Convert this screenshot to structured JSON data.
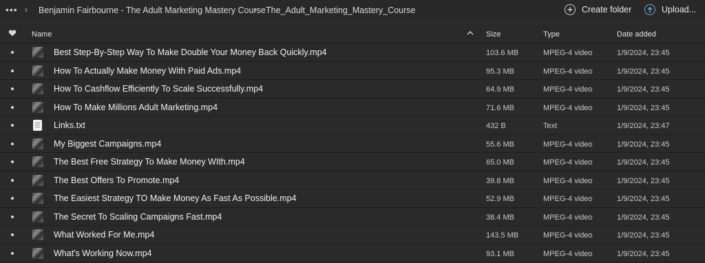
{
  "breadcrumb": {
    "more_label": "•••",
    "items": [
      "Benjamin Fairbourne - The Adult Marketing Mastery Course",
      "The_Adult_Marketing_Mastery_Course"
    ]
  },
  "actions": {
    "create_folder": "Create folder",
    "upload": "Upload..."
  },
  "columns": {
    "name": "Name",
    "size": "Size",
    "type": "Type",
    "date": "Date added"
  },
  "files": [
    {
      "name": "Best Step-By-Step Way To Make Double Your Money Back Quickly.mp4",
      "size": "103.6 MB",
      "type": "MPEG-4 video",
      "date": "1/9/2024, 23:45",
      "icon": "video-thumbnail"
    },
    {
      "name": "How To Actually Make Money With Paid Ads.mp4",
      "size": "95.3 MB",
      "type": "MPEG-4 video",
      "date": "1/9/2024, 23:45",
      "icon": "video-thumbnail"
    },
    {
      "name": "How To Cashflow Efficiently To Scale Successfully.mp4",
      "size": "64.9 MB",
      "type": "MPEG-4 video",
      "date": "1/9/2024, 23:45",
      "icon": "video-thumbnail"
    },
    {
      "name": "How To Make Millions Adult Marketing.mp4",
      "size": "71.6 MB",
      "type": "MPEG-4 video",
      "date": "1/9/2024, 23:45",
      "icon": "video-thumbnail"
    },
    {
      "name": "Links.txt",
      "size": "432 B",
      "type": "Text",
      "date": "1/9/2024, 23:47",
      "icon": "document-icon"
    },
    {
      "name": "My Biggest Campaigns.mp4",
      "size": "55.6 MB",
      "type": "MPEG-4 video",
      "date": "1/9/2024, 23:45",
      "icon": "video-thumbnail"
    },
    {
      "name": "The Best Free Strategy To Make Money WIth.mp4",
      "size": "65.0 MB",
      "type": "MPEG-4 video",
      "date": "1/9/2024, 23:45",
      "icon": "video-thumbnail"
    },
    {
      "name": "The Best Offers To Promote.mp4",
      "size": "39.8 MB",
      "type": "MPEG-4 video",
      "date": "1/9/2024, 23:45",
      "icon": "video-thumbnail"
    },
    {
      "name": "The Easiest Strategy TO Make Money As Fast As Possible.mp4",
      "size": "52.9 MB",
      "type": "MPEG-4 video",
      "date": "1/9/2024, 23:45",
      "icon": "video-thumbnail"
    },
    {
      "name": "The Secret To Scaling Campaigns Fast.mp4",
      "size": "38.4 MB",
      "type": "MPEG-4 video",
      "date": "1/9/2024, 23:45",
      "icon": "video-thumbnail"
    },
    {
      "name": "What Worked For Me.mp4",
      "size": "143.5 MB",
      "type": "MPEG-4 video",
      "date": "1/9/2024, 23:45",
      "icon": "video-thumbnail"
    },
    {
      "name": "What's Working Now.mp4",
      "size": "93.1 MB",
      "type": "MPEG-4 video",
      "date": "1/9/2024, 23:45",
      "icon": "video-thumbnail"
    }
  ],
  "colors": {
    "background": "#2a2a2b",
    "upload_accent": "#6fa8dc"
  }
}
